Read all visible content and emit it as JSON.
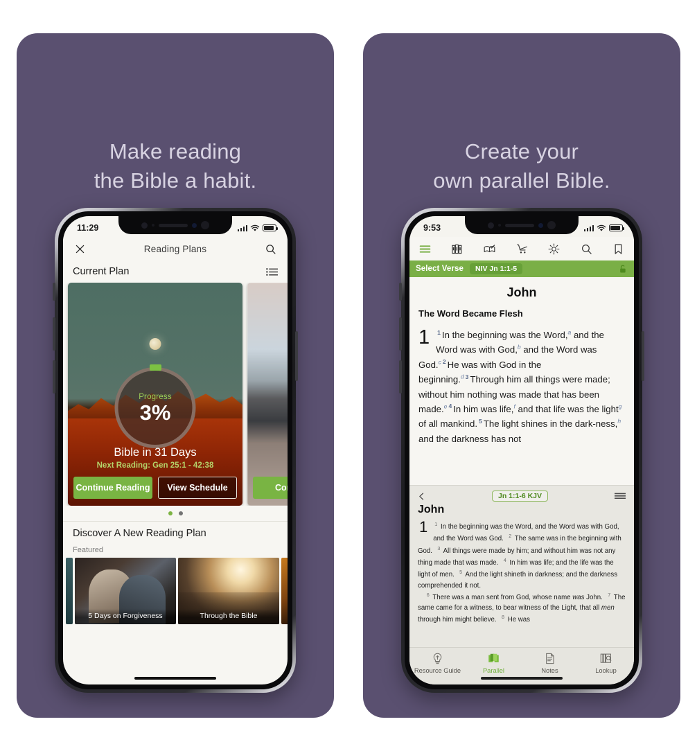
{
  "theme": {
    "background_purple": "#5a5070",
    "accent_green": "#7aaf46",
    "chip_green": "#67a038",
    "headline_color": "#d8d3e2",
    "screen_bg": "#f7f6f2"
  },
  "panels": [
    {
      "headline_line1": "Make reading",
      "headline_line2": "the Bible a habit."
    },
    {
      "headline_line1": "Create your",
      "headline_line2": "own parallel Bible."
    }
  ],
  "left_phone": {
    "status": {
      "time": "11:29",
      "signal_icon": "cellular-bars-icon",
      "wifi_icon": "wifi-icon",
      "battery_icon": "battery-icon"
    },
    "navbar": {
      "close_icon": "close-icon",
      "title": "Reading Plans",
      "search_icon": "search-icon"
    },
    "section": {
      "title": "Current Plan",
      "list_icon": "list-view-icon"
    },
    "plan_card": {
      "progress_label": "Progress",
      "progress_value": "3%",
      "progress_percent": 3,
      "title": "Bible in 31 Days",
      "next_reading": "Next Reading: Gen 25:1 - 42:38",
      "primary_button": "Continue Reading",
      "secondary_button": "View Schedule",
      "art_icon": "moon-over-mountains-image"
    },
    "plan_card_peek": {
      "primary_button": "Conti",
      "art_icon": "beach-road-image"
    },
    "pager": {
      "total": 2,
      "active": 1
    },
    "discover": {
      "title": "Discover A New Reading Plan",
      "subtitle": "Featured",
      "cards": [
        {
          "caption": "5 Days on Forgiveness",
          "art_icon": "people-praying-image"
        },
        {
          "caption": "Through the Bible",
          "art_icon": "sunlit-window-image"
        }
      ]
    }
  },
  "right_phone": {
    "status": {
      "time": "9:53",
      "signal_icon": "cellular-bars-icon",
      "wifi_icon": "wifi-icon",
      "battery_icon": "battery-icon"
    },
    "toolbar": [
      {
        "name": "menu-icon",
        "label": "Menu"
      },
      {
        "name": "library-icon",
        "label": "Library"
      },
      {
        "name": "study-icon",
        "label": "Study"
      },
      {
        "name": "cart-icon",
        "label": "Store"
      },
      {
        "name": "gear-icon",
        "label": "Settings"
      },
      {
        "name": "search-icon",
        "label": "Search"
      },
      {
        "name": "bookmark-icon",
        "label": "Bookmark"
      }
    ],
    "verse_bar": {
      "label": "Select Verse",
      "chip": "NIV Jn 1:1-5",
      "lock_icon": "unlocked-padlock-icon"
    },
    "niv_pane": {
      "book": "John",
      "section_title": "The Word Became Flesh",
      "chapter": "1",
      "verses": [
        {
          "num": "1",
          "text": "In the beginning was the Word,",
          "footnote": "a",
          "tail": " and the Word was with God,",
          "footnote2": "b",
          "tail2": " and the Word was God.",
          "footnote3": "c"
        },
        {
          "num": "2",
          "text": "He was with God in the beginning.",
          "footnote": "d"
        },
        {
          "num": "3",
          "text": "Through him all things were made; without him nothing was made that has been made.",
          "footnote": "e"
        },
        {
          "num": "4",
          "text": "In him was life,",
          "footnote": "f",
          "tail": " and that life was the light",
          "footnote2": "g",
          "tail2": " of all mankind."
        },
        {
          "num": "5",
          "text": "The light shines in the dark-ness,",
          "footnote": "h",
          "tail": " and the darkness has not"
        }
      ]
    },
    "kjv_pane": {
      "back_icon": "chevron-left-icon",
      "chip": "Jn 1:1-6 KJV",
      "menu_icon": "hamburger-lines-icon",
      "book": "John",
      "chapter": "1",
      "verses": [
        {
          "num": "1",
          "text": "In the beginning was the Word, and the Word was with God, and the Word was God."
        },
        {
          "num": "2",
          "text": "The same was in the beginning with God."
        },
        {
          "num": "3",
          "text": "All things were made by him; and without him was not any thing made that was made."
        },
        {
          "num": "4",
          "text": "In him was life; and the life was the light of men."
        },
        {
          "num": "5",
          "text": "And the light shineth in darkness; and the darkness comprehended it not."
        },
        {
          "num": "6",
          "text": "There was a man sent from God, whose name was John."
        },
        {
          "num": "7",
          "text": "The same came for a witness, to bear witness of the Light, that all men through him might believe."
        },
        {
          "num": "8",
          "text": "He was"
        }
      ]
    },
    "tabbar": [
      {
        "label": "Resource Guide",
        "icon": "lightbulb-icon",
        "active": false
      },
      {
        "label": "Parallel",
        "icon": "parallel-books-icon",
        "active": true
      },
      {
        "label": "Notes",
        "icon": "note-page-icon",
        "active": false
      },
      {
        "label": "Lookup",
        "icon": "lookup-books-icon",
        "active": false
      }
    ]
  }
}
